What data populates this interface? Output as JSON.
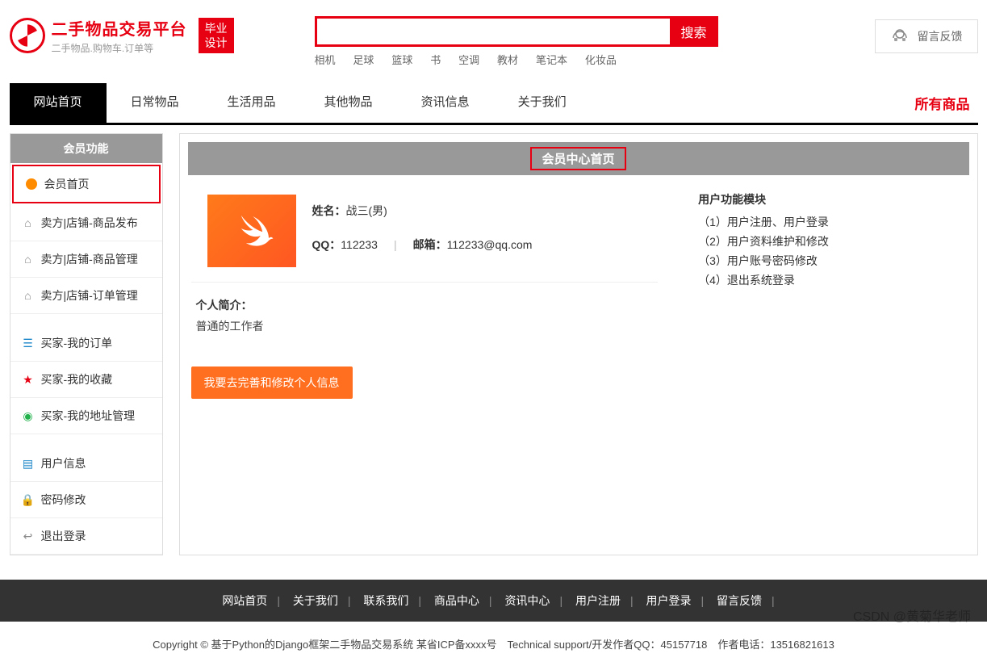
{
  "header": {
    "title": "二手物品交易平台",
    "subtitle": "二手物品.购物车.订单等",
    "badge_line1": "毕业",
    "badge_line2": "设计",
    "search_button": "搜索",
    "feedback": "留言反馈",
    "hot_words": [
      "相机",
      "足球",
      "篮球",
      "书",
      "空调",
      "教材",
      "笔记本",
      "化妆品"
    ]
  },
  "nav": {
    "items": [
      "网站首页",
      "日常物品",
      "生活用品",
      "其他物品",
      "资讯信息",
      "关于我们"
    ],
    "all_products": "所有商品"
  },
  "sidebar": {
    "title": "会员功能",
    "items": [
      {
        "label": "会员首页",
        "icon": "orange-dot",
        "highlight": true
      },
      {
        "label": "卖方|店铺-商品发布",
        "icon": "house"
      },
      {
        "label": "卖方|店铺-商品管理",
        "icon": "house"
      },
      {
        "label": "卖方|店铺-订单管理",
        "icon": "house"
      },
      {
        "label": "买家-我的订单",
        "icon": "doc"
      },
      {
        "label": "买家-我的收藏",
        "icon": "star"
      },
      {
        "label": "买家-我的地址管理",
        "icon": "loc"
      },
      {
        "label": "用户信息",
        "icon": "doc"
      },
      {
        "label": "密码修改",
        "icon": "lock"
      },
      {
        "label": "退出登录",
        "icon": "arrow"
      }
    ]
  },
  "content": {
    "header": "会员中心首页",
    "name_label": "姓名：",
    "name_value": "战三(男)",
    "qq_label": "QQ：",
    "qq_value": "112233",
    "email_label": "邮箱：",
    "email_value": "112233@qq.com",
    "intro_label": "个人简介：",
    "intro_text": "普通的工作者",
    "edit_button": "我要去完善和修改个人信息",
    "module_title": "用户功能模块",
    "module_items": [
      "（1）用户注册、用户登录",
      "（2）用户资料维护和修改",
      "（3）用户账号密码修改",
      "（4）退出系统登录"
    ]
  },
  "footer": {
    "links": [
      "网站首页",
      "关于我们",
      "联系我们",
      "商品中心",
      "资讯中心",
      "用户注册",
      "用户登录",
      "留言反馈"
    ],
    "copyright": "Copyright © 基于Python的Django框架二手物品交易系统 某省ICP备xxxx号　Technical support/开发作者QQ：45157718　作者电话：13516821613"
  },
  "watermark": "CSDN @黄菊华老师"
}
